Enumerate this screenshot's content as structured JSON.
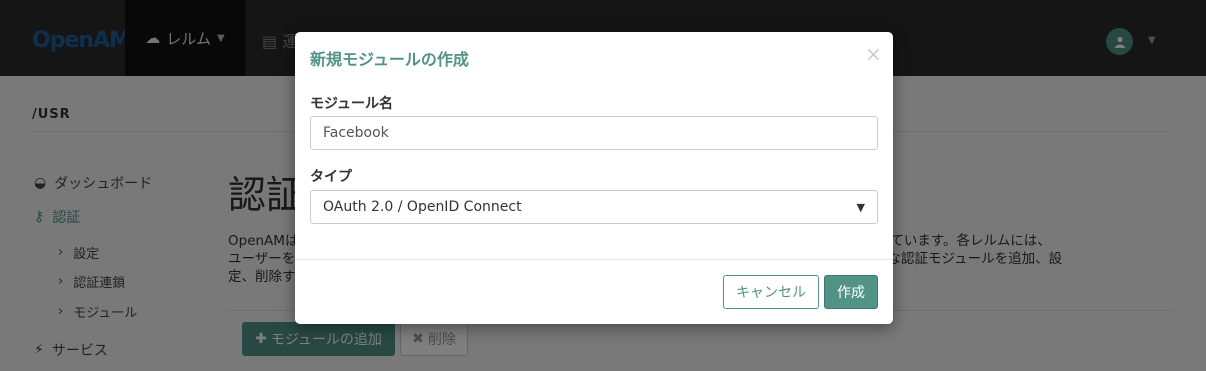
{
  "navbar": {
    "logo": "OpenAM",
    "realm_menu": "レルム",
    "deploy_fragment": "運"
  },
  "page": {
    "realm_path": "/USR",
    "title_fragment": "認証",
    "description_line1": "OpenAMは                                                                                                                    と関連付けられています。各レルムには、",
    "description_line2": "ユーザーを                                                                                                                    認証に利用可能な認証モジュールを追加、設",
    "description_line3": "定、削除す",
    "add_module_button": "モジュールの追加",
    "delete_button": "削除"
  },
  "sidebar": {
    "items": [
      {
        "label": "ダッシュボード",
        "icon": "dashboard-icon"
      },
      {
        "label": "認証",
        "icon": "key-icon"
      },
      {
        "label": "設定"
      },
      {
        "label": "認証連鎖"
      },
      {
        "label": "モジュール"
      },
      {
        "label": "サービス",
        "icon": "plug-icon"
      }
    ]
  },
  "modal": {
    "title": "新規モジュールの作成",
    "close": "×",
    "name_label": "モジュール名",
    "name_value": "Facebook",
    "type_label": "タイプ",
    "type_value": "OAuth 2.0 / OpenID Connect",
    "cancel_button": "キャンセル",
    "create_button": "作成"
  },
  "colors": {
    "accent": "#519387",
    "navbar": "#2a2a2a",
    "navbar_active": "#111111"
  }
}
